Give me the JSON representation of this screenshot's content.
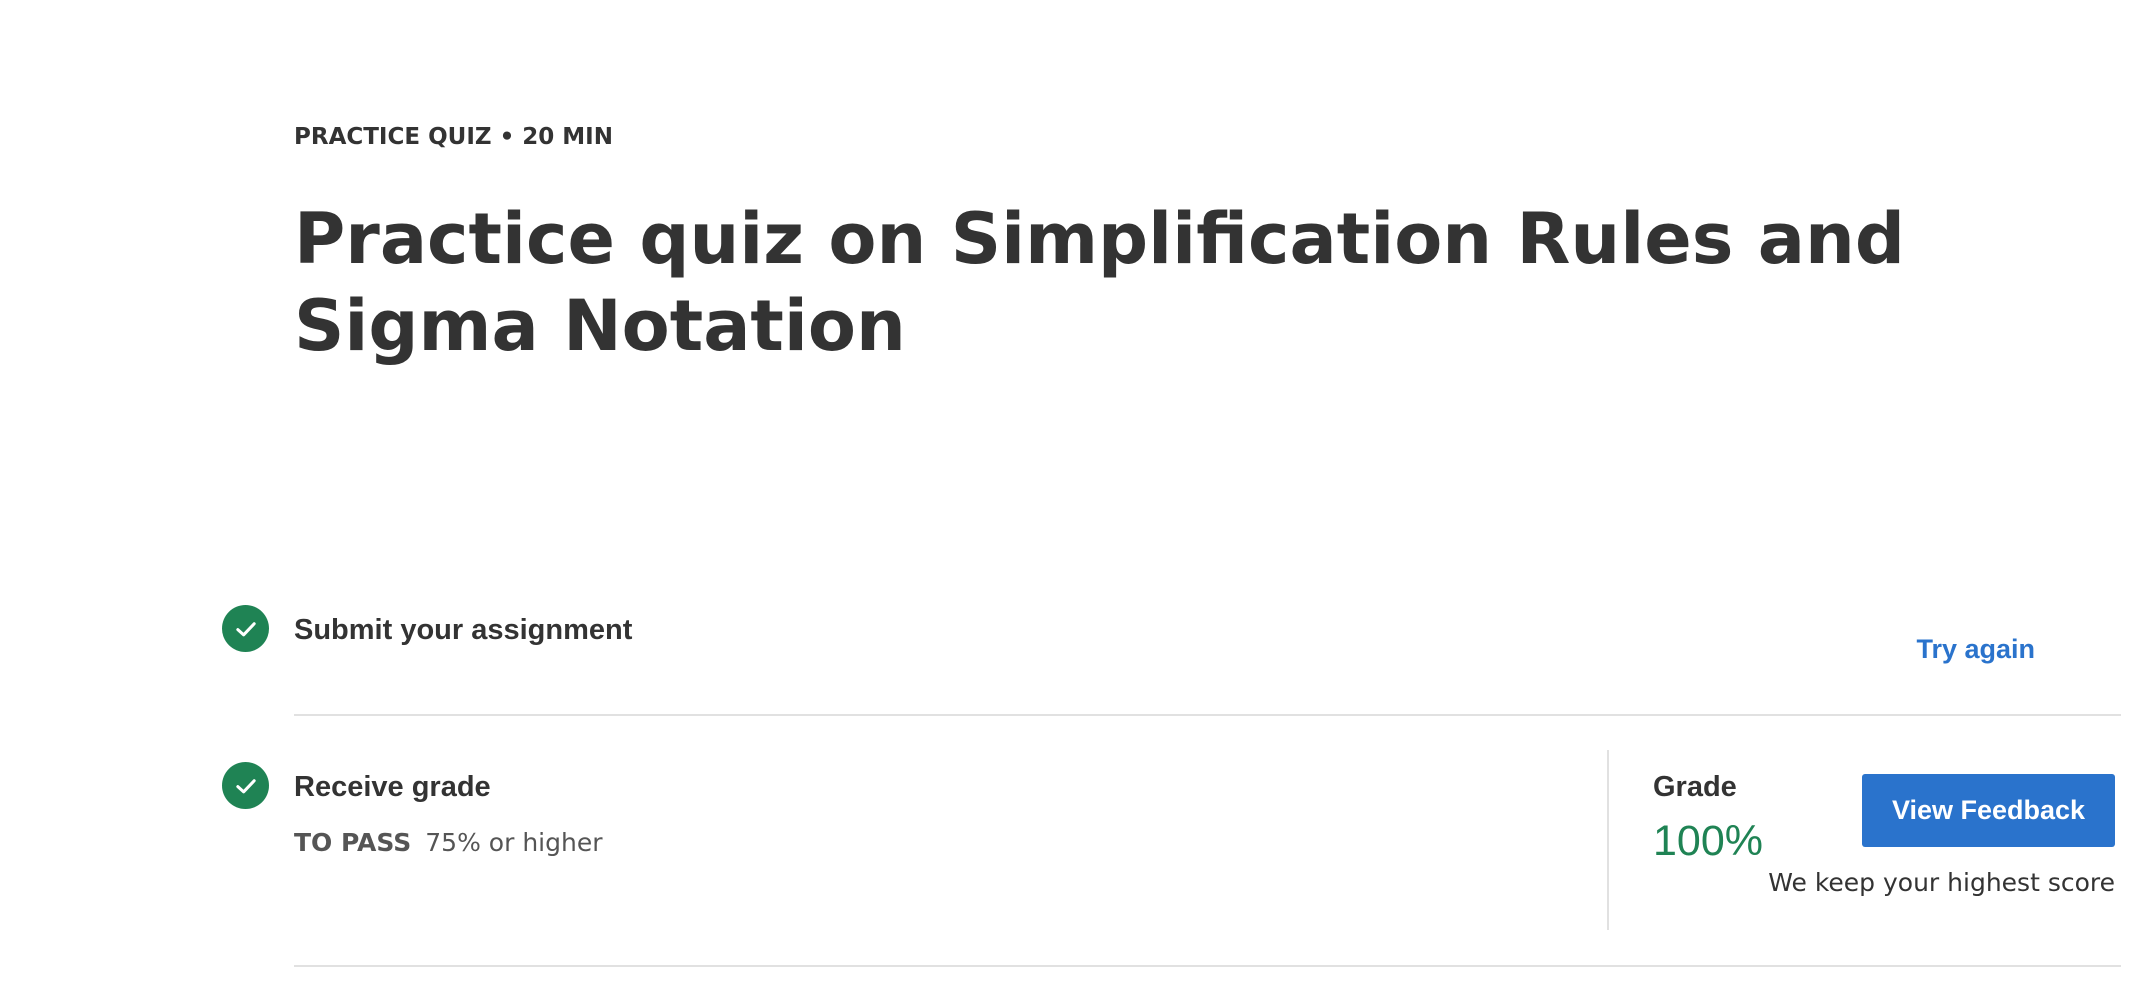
{
  "header": {
    "item_type": "PRACTICE QUIZ",
    "separator": "•",
    "duration": "20 MIN",
    "title": "Practice quiz on Simplification Rules and Sigma Notation"
  },
  "steps": [
    {
      "title": "Submit your assignment",
      "icon": "check-circle-icon",
      "status": "complete",
      "action_label": "Try again"
    },
    {
      "title": "Receive grade",
      "icon": "check-circle-icon",
      "status": "complete",
      "to_pass_label": "TO PASS",
      "to_pass_value": "75% or higher"
    }
  ],
  "grade": {
    "label": "Grade",
    "value": "100%",
    "button_label": "View Feedback",
    "note": "We keep your highest score"
  },
  "colors": {
    "success": "#1f8354",
    "primary": "#2a73cc",
    "text": "#333333",
    "divider": "#e1e1e1"
  }
}
